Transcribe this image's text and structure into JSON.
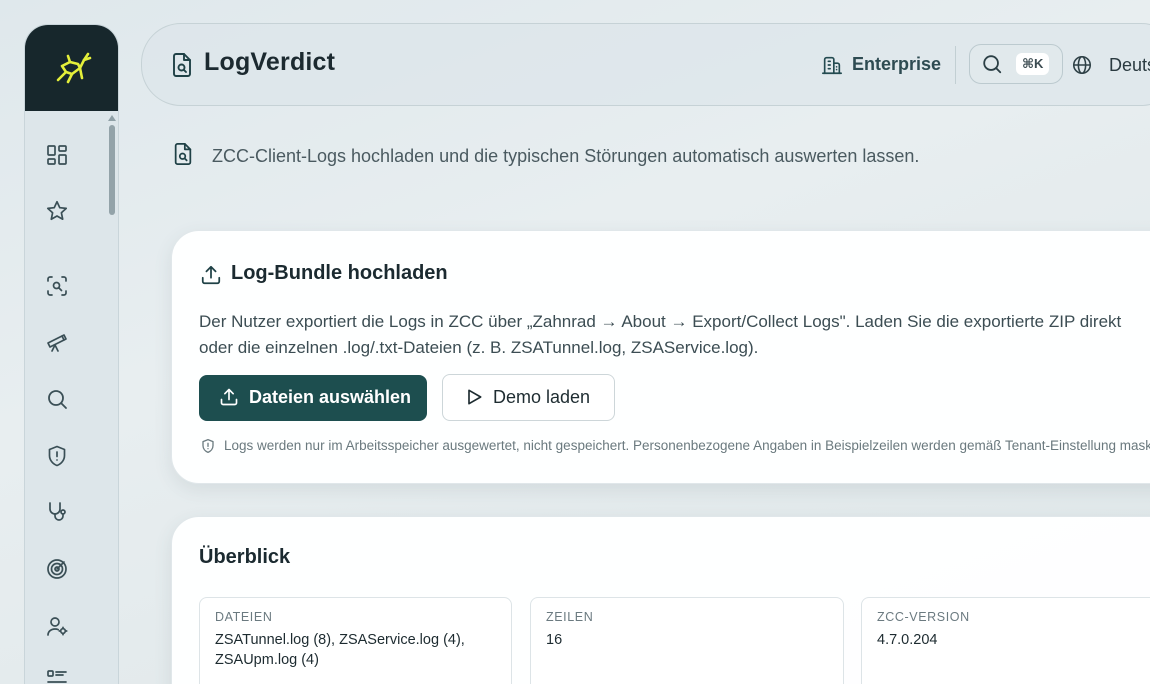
{
  "app": {
    "title": "LogVerdict",
    "plan_label": "Enterprise",
    "search_shortcut": "⌘K",
    "language_label": "Deutsch",
    "accent_color": "#1d4e4f",
    "logo_color": "#e4ef3a"
  },
  "sidebar": {
    "items": [
      {
        "name": "dashboard-icon"
      },
      {
        "name": "star-icon"
      },
      {
        "name": "scan-search-icon"
      },
      {
        "name": "telescope-icon"
      },
      {
        "name": "search-icon"
      },
      {
        "name": "shield-alert-icon"
      },
      {
        "name": "stethoscope-icon"
      },
      {
        "name": "target-icon"
      },
      {
        "name": "user-settings-icon"
      },
      {
        "name": "list-icon"
      }
    ]
  },
  "intro": {
    "text": "ZCC-Client-Logs hochladen und die typischen Störungen automatisch auswerten lassen."
  },
  "upload": {
    "title": "Log-Bundle hochladen",
    "description_line1": "Der Nutzer exportiert die Logs in ZCC über „Zahnrad → About → Export/Collect Logs\". Laden Sie die exportierte ZIP direkt",
    "description_line2": "oder die einzelnen .log/.txt-Dateien (z. B. ZSATunnel.log, ZSAService.log).",
    "select_button": "Dateien auswählen",
    "demo_button": "Demo laden",
    "privacy_note": "Logs werden nur im Arbeitsspeicher ausgewertet, nicht gespeichert. Personenbezogene Angaben in Beispielzeilen werden gemäß Tenant-Einstellung maskiert."
  },
  "overview": {
    "title": "Überblick",
    "stats": [
      {
        "label": "DATEIEN",
        "value": "ZSATunnel.log (8), ZSAService.log (4), ZSAUpm.log (4)"
      },
      {
        "label": "ZEILEN",
        "value": "16"
      },
      {
        "label": "ZCC-VERSION",
        "value": "4.7.0.204"
      }
    ]
  }
}
